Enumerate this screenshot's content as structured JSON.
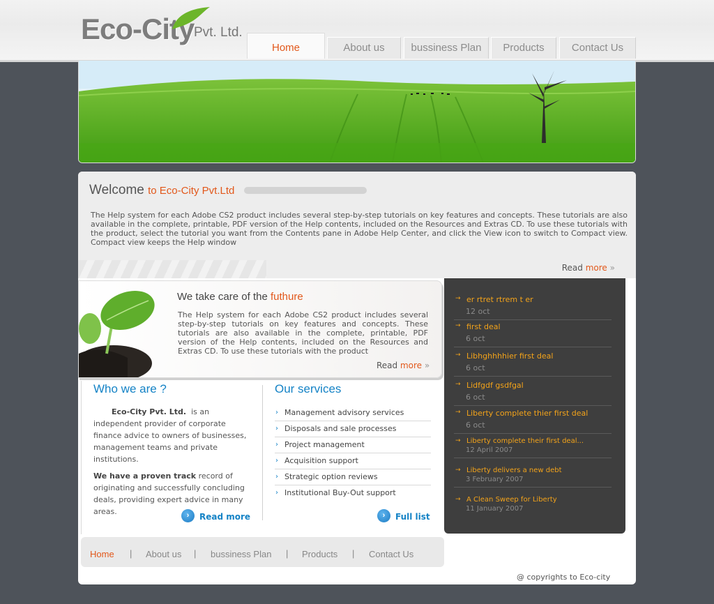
{
  "brand": {
    "name": "Eco-City",
    "suffix": "Pvt. Ltd."
  },
  "nav": [
    {
      "label": "Home",
      "active": true
    },
    {
      "label": "About us",
      "active": false
    },
    {
      "label": "bussiness Plan",
      "active": false
    },
    {
      "label": "Products",
      "active": false
    },
    {
      "label": "Contact Us",
      "active": false
    }
  ],
  "welcome": {
    "title": "Welcome",
    "title_highlight": "to Eco-City Pvt.Ltd",
    "body": "The Help system for each Adobe CS2 product includes several step-by-step tutorials on key features and concepts. These tutorials are also available in the complete, printable, PDF version of the Help contents, included on the Resources and Extras CD. To use these tutorials with the product, select the tutorial you want from the Contents pane in Adobe Help Center, and click the View icon  to switch to Compact view. Compact view keeps the Help window",
    "read": "Read",
    "more": "more",
    "arrows": "»"
  },
  "future": {
    "title": "We take care of the",
    "title_highlight": "futhure",
    "body": "The Help system for each Adobe CS2 product includes several step-by-step tutorials on key features and concepts. These tutorials are also available in the complete, printable, PDF version of the Help contents, included on the Resources and Extras CD. To use these tutorials with the product",
    "read": "Read",
    "more": "more",
    "arrows": "»"
  },
  "who": {
    "title": "Who we are ?",
    "company": "Eco-City Pvt. Ltd.",
    "text1": "is an independent provider of corporate finance advice to owners of businesses, management teams and private institutions.",
    "bold2": "We have a proven track",
    "text2": "record of originating and successfully concluding deals, providing expert advice in many areas.",
    "link": "Read more"
  },
  "services": {
    "title": "Our services",
    "items": [
      "Management advisory services",
      "Disposals and sale processes",
      "Project management",
      "Acquisition support",
      "Strategic option reviews",
      "Institutional Buy-Out support"
    ],
    "link": "Full list"
  },
  "news": [
    {
      "title": "er rtret rtrem t er",
      "date": "12 oct"
    },
    {
      "title": "first deal",
      "date": "6 oct"
    },
    {
      "title": "Libhghhhhier first deal",
      "date": "6 oct"
    },
    {
      "title": "Lidfgdf gsdfgal",
      "date": "6 oct"
    },
    {
      "title": "Liberty complete thier first deal",
      "date": "6 oct"
    },
    {
      "title": "Liberty complete their first deal...",
      "date": "12 April 2007"
    },
    {
      "title": "Liberty delivers a new debt",
      "date": "3 February 2007"
    },
    {
      "title": "A Clean Sweep for Liberty",
      "date": "11 January 2007"
    }
  ],
  "footer": {
    "nav": [
      "Home",
      "About us",
      "bussiness Plan",
      "Products",
      "Contact Us"
    ],
    "separator": "|",
    "copyright": "@ copyrights to Eco-city"
  },
  "colors": {
    "accent": "#e2581b",
    "link": "#1583c6",
    "news_title": "#f3a31a",
    "background": "#4e535a"
  }
}
